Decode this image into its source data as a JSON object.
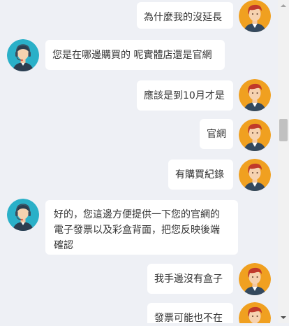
{
  "chat": {
    "messages": [
      {
        "sender": "customer",
        "text": "為什麼我的沒延長"
      },
      {
        "sender": "agent",
        "text": "您是在哪邊購買的 呢實體店還是官網"
      },
      {
        "sender": "customer",
        "text": "應該是到10月才是"
      },
      {
        "sender": "customer",
        "text": "官網"
      },
      {
        "sender": "customer",
        "text": "有購買紀錄"
      },
      {
        "sender": "agent",
        "lines": [
          "好的，您這邊方便提供一下您的官網的",
          "電子發票以及彩盒背面，把您反映後端",
          "確認"
        ]
      },
      {
        "sender": "customer",
        "text": "我手邊沒有盒子"
      },
      {
        "sender": "customer",
        "text": "發票可能也不在"
      }
    ]
  },
  "colors": {
    "background": "#eef0f5",
    "bubble": "#ffffff",
    "text": "#333333",
    "customer_avatar_bg": "#f0a020",
    "agent_avatar_bg": "#2ab0c8"
  },
  "icons": {
    "customer_avatar": "customer-avatar-icon",
    "agent_avatar": "agent-headset-avatar-icon"
  }
}
